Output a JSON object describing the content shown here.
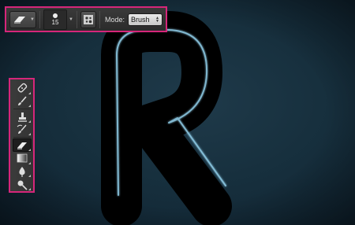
{
  "options_bar": {
    "brush_size": "15",
    "mode_label": "Mode:",
    "mode_value": "Brush",
    "highlight_color": "#d6267a"
  },
  "tools": [
    {
      "name": "spot-healing-brush-icon",
      "active": false
    },
    {
      "name": "brush-icon",
      "active": false
    },
    {
      "name": "clone-stamp-icon",
      "active": false
    },
    {
      "name": "history-brush-icon",
      "active": false
    },
    {
      "name": "eraser-icon",
      "active": true
    },
    {
      "name": "gradient-icon",
      "active": false
    },
    {
      "name": "blur-icon",
      "active": false
    },
    {
      "name": "dodge-icon",
      "active": false
    }
  ],
  "canvas": {
    "glyph": "R",
    "background_color": "#17303e",
    "glyph_color": "#000000",
    "stroke_color": "#8ecbe6"
  }
}
